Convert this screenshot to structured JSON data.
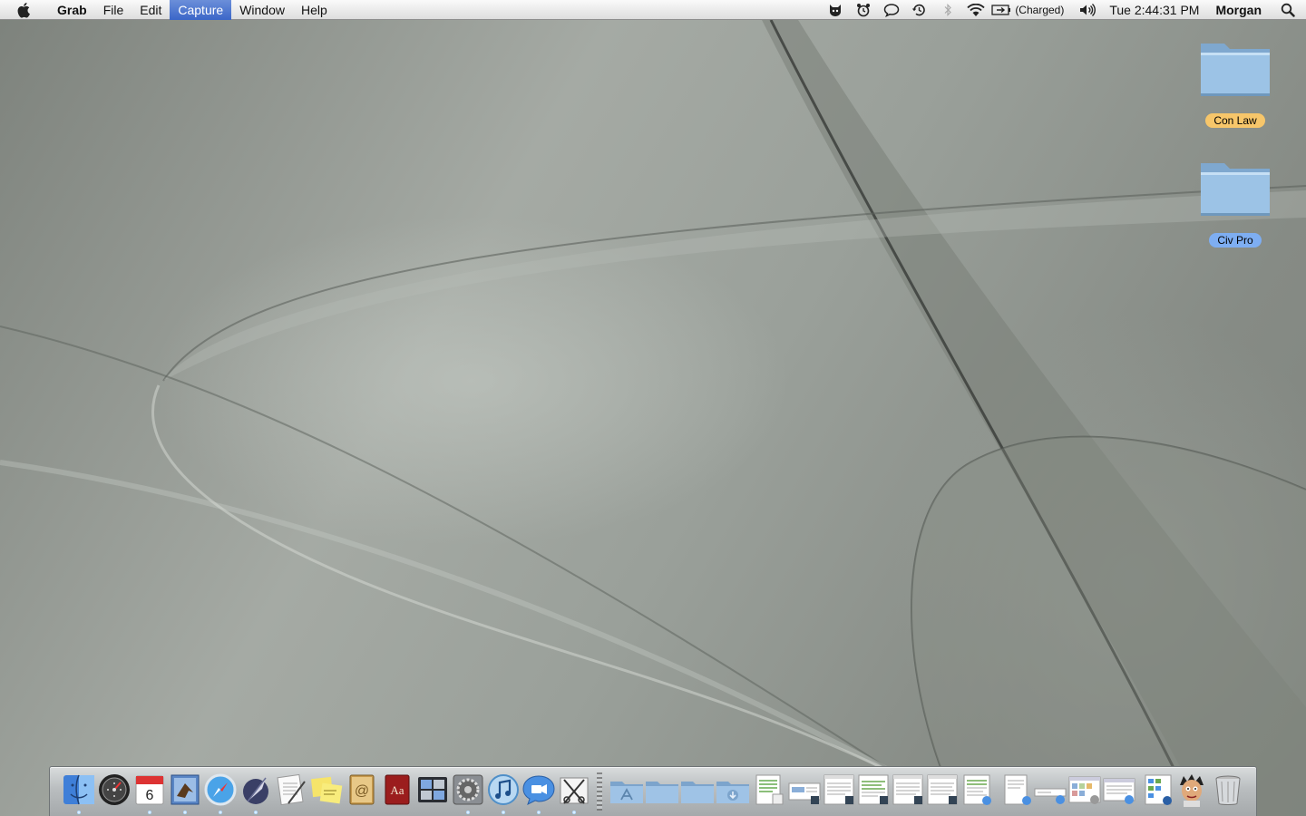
{
  "menubar": {
    "app_name": "Grab",
    "menus": [
      "File",
      "Edit",
      "Capture",
      "Window",
      "Help"
    ],
    "active_menu": "Capture",
    "battery_text": "(Charged)",
    "clock": "Tue 2:44:31 PM",
    "user": "Morgan",
    "status_icons": [
      "growl-icon",
      "alarm-clock-icon",
      "chat-bubble-icon",
      "time-machine-icon",
      "bluetooth-icon",
      "wifi-icon",
      "battery-icon",
      "volume-icon"
    ]
  },
  "desktop": {
    "folders": [
      {
        "name": "Con Law",
        "label_color": "#f7c66a"
      },
      {
        "name": "Civ Pro",
        "label_color": "#7eaef2"
      }
    ]
  },
  "dock": {
    "apps": [
      {
        "name": "finder-icon",
        "running": true
      },
      {
        "name": "dashboard-icon",
        "running": false
      },
      {
        "name": "ical-icon",
        "running": true,
        "date": "6"
      },
      {
        "name": "mail-icon",
        "running": true
      },
      {
        "name": "safari-icon",
        "running": true
      },
      {
        "name": "quill-app-icon",
        "running": true
      },
      {
        "name": "textedit-icon",
        "running": false
      },
      {
        "name": "stickies-icon",
        "running": false
      },
      {
        "name": "address-book-icon",
        "running": false
      },
      {
        "name": "dictionary-icon",
        "running": false
      },
      {
        "name": "spaces-icon",
        "running": false
      },
      {
        "name": "system-preferences-icon",
        "running": true
      },
      {
        "name": "itunes-icon",
        "running": true
      },
      {
        "name": "ichat-icon",
        "running": true
      },
      {
        "name": "grab-icon",
        "running": true
      }
    ],
    "stacks": [
      {
        "name": "applications-folder-icon"
      },
      {
        "name": "documents-folder-icon"
      },
      {
        "name": "folder-icon"
      },
      {
        "name": "downloads-folder-icon"
      }
    ],
    "documents": [
      "document-thumbnail-1",
      "document-thumbnail-2",
      "document-thumbnail-3",
      "document-thumbnail-4",
      "document-thumbnail-5",
      "document-thumbnail-6",
      "document-thumbnail-7",
      "document-thumbnail-8",
      "document-thumbnail-9",
      "document-thumbnail-10",
      "document-thumbnail-11",
      "document-thumbnail-12"
    ],
    "ical_date": "6"
  }
}
